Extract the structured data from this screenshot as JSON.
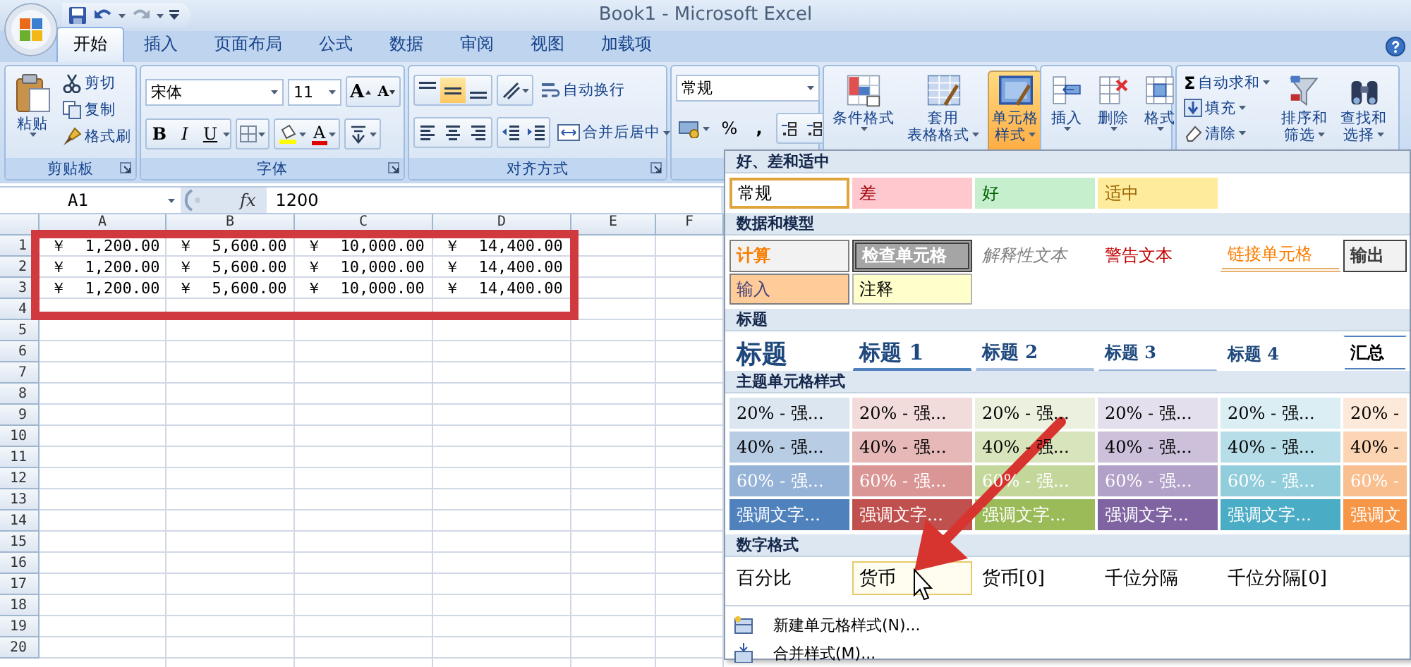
{
  "window": {
    "title": "Book1 - Microsoft Excel"
  },
  "tabs": [
    {
      "label": "开始",
      "selected": true
    },
    {
      "label": "插入",
      "selected": false
    },
    {
      "label": "页面布局",
      "selected": false
    },
    {
      "label": "公式",
      "selected": false
    },
    {
      "label": "数据",
      "selected": false
    },
    {
      "label": "审阅",
      "selected": false
    },
    {
      "label": "视图",
      "selected": false
    },
    {
      "label": "加载项",
      "selected": false
    }
  ],
  "ribbon": {
    "clipboard": {
      "label": "剪贴板",
      "paste": "粘贴",
      "commands": [
        "剪切",
        "复制",
        "格式刷"
      ]
    },
    "font": {
      "label": "字体",
      "font_name": "宋体",
      "font_size": "11",
      "grow": "A",
      "shrink": "A",
      "styles": [
        "B",
        "I",
        "U"
      ],
      "font_color": "A"
    },
    "alignment": {
      "label": "对齐方式",
      "wrap": "自动换行",
      "merge": "合并后居中"
    },
    "number": {
      "format": "常规",
      "percent": "%",
      "comma": ","
    },
    "styles": {
      "buttons": [
        {
          "lines": [
            "条件格式"
          ],
          "selected": false
        },
        {
          "lines": [
            "套用",
            "表格格式"
          ],
          "selected": false
        },
        {
          "lines": [
            "单元格",
            "样式"
          ],
          "selected": true
        }
      ]
    },
    "cells": {
      "buttons": [
        "插入",
        "删除",
        "格式"
      ]
    },
    "editing": {
      "sum_symbol": "Σ",
      "commands": [
        "自动求和",
        "填充",
        "清除"
      ],
      "buttons": [
        [
          "排序和",
          "筛选"
        ],
        [
          "查找和",
          "选择"
        ]
      ]
    }
  },
  "formula_bar": {
    "name_box": "A1",
    "function_label": "fx",
    "value": "1200"
  },
  "sheet": {
    "columns": [
      "A",
      "B",
      "C",
      "D",
      "E",
      "F"
    ],
    "rows": [
      {
        "label": "1",
        "cells": [
          "￥  1,200.00",
          "￥  5,600.00",
          "￥  10,000.00",
          "￥  14,400.00"
        ]
      },
      {
        "label": "2",
        "cells": [
          "￥  1,200.00",
          "￥  5,600.00",
          "￥  10,000.00",
          "￥  14,400.00"
        ]
      },
      {
        "label": "3",
        "cells": [
          "￥  1,200.00",
          "￥  5,600.00",
          "￥  10,000.00",
          "￥  14,400.00"
        ]
      },
      {
        "label": "4"
      },
      {
        "label": "5"
      },
      {
        "label": "6"
      },
      {
        "label": "7"
      },
      {
        "label": "8"
      },
      {
        "label": "9"
      },
      {
        "label": "10"
      },
      {
        "label": "11"
      },
      {
        "label": "12"
      },
      {
        "label": "13"
      },
      {
        "label": "14"
      },
      {
        "label": "15"
      },
      {
        "label": "16"
      },
      {
        "label": "17"
      },
      {
        "label": "18"
      },
      {
        "label": "19"
      },
      {
        "label": "20"
      }
    ]
  },
  "style_gallery": {
    "sections": [
      {
        "title": "好、差和适中",
        "rows": [
          {
            "items": [
              {
                "label": "常规",
                "kind": "normal",
                "selected": true
              },
              {
                "label": "差",
                "kind": "bad",
                "selected": false
              },
              {
                "label": "好",
                "kind": "good",
                "selected": false
              },
              {
                "label": "适中",
                "kind": "neutral",
                "selected": false
              }
            ]
          }
        ]
      },
      {
        "title": "数据和模型",
        "rows": [
          {
            "items": [
              {
                "label": "计算",
                "kind": "calculation"
              },
              {
                "label": "检查单元格",
                "kind": "check"
              },
              {
                "label": "解释性文本",
                "kind": "explanatory"
              },
              {
                "label": "警告文本",
                "kind": "warning"
              },
              {
                "label": "链接单元格",
                "kind": "linked"
              },
              {
                "label": "输出",
                "kind": "output"
              }
            ]
          },
          {
            "items": [
              {
                "label": "输入",
                "kind": "input"
              },
              {
                "label": "注释",
                "kind": "note"
              }
            ]
          }
        ]
      },
      {
        "title": "标题",
        "rows": [
          {
            "items": [
              {
                "label": "标题",
                "kind": "title"
              },
              {
                "label": "标题 1",
                "kind": "heading1"
              },
              {
                "label": "标题 2",
                "kind": "heading2"
              },
              {
                "label": "标题 3",
                "kind": "heading3"
              },
              {
                "label": "标题 4",
                "kind": "heading4"
              },
              {
                "label": "汇总",
                "kind": "total"
              }
            ]
          }
        ]
      },
      {
        "title": "主题单元格样式",
        "rows": [
          {
            "kind": "light",
            "items": [
              {
                "label": "20% - 强...",
                "kind": "accent",
                "color": "#dce6f1"
              },
              {
                "label": "20% - 强...",
                "kind": "accent",
                "color": "#f2dcdb"
              },
              {
                "label": "20% - 强...",
                "kind": "accent",
                "color": "#ebf1de"
              },
              {
                "label": "20% - 强...",
                "kind": "accent",
                "color": "#e4dfec"
              },
              {
                "label": "20% - 强...",
                "kind": "accent",
                "color": "#daeef3"
              },
              {
                "label": "20% -",
                "kind": "accent",
                "color": "#fde9d9"
              }
            ]
          },
          {
            "kind": "light",
            "items": [
              {
                "label": "40% - 强...",
                "kind": "accent",
                "color": "#b8cce4"
              },
              {
                "label": "40% - 强...",
                "kind": "accent",
                "color": "#e6b8b7"
              },
              {
                "label": "40% - 强...",
                "kind": "accent",
                "color": "#d8e4bc"
              },
              {
                "label": "40% - 强...",
                "kind": "accent",
                "color": "#ccc0da"
              },
              {
                "label": "40% - 强...",
                "kind": "accent",
                "color": "#b7dee8"
              },
              {
                "label": "40% -",
                "kind": "accent",
                "color": "#fcd5b4"
              }
            ]
          },
          {
            "kind": "dark",
            "items": [
              {
                "label": "60% - 强...",
                "kind": "accent",
                "color": "#95b3d7"
              },
              {
                "label": "60% - 强...",
                "kind": "accent",
                "color": "#da9694"
              },
              {
                "label": "60% - 强...",
                "kind": "accent",
                "color": "#c4d79b"
              },
              {
                "label": "60% - 强...",
                "kind": "accent",
                "color": "#b1a0c7"
              },
              {
                "label": "60% - 强...",
                "kind": "accent",
                "color": "#92cddc"
              },
              {
                "label": "60% -",
                "kind": "accent",
                "color": "#fabf8f"
              }
            ]
          },
          {
            "kind": "dark",
            "items": [
              {
                "label": "强调文字...",
                "kind": "accent",
                "color": "#4f81bd"
              },
              {
                "label": "强调文字...",
                "kind": "accent",
                "color": "#c0504d"
              },
              {
                "label": "强调文字...",
                "kind": "accent",
                "color": "#9bbb59"
              },
              {
                "label": "强调文字...",
                "kind": "accent",
                "color": "#8064a2"
              },
              {
                "label": "强调文字...",
                "kind": "accent",
                "color": "#4bacc6"
              },
              {
                "label": "强调文",
                "kind": "accent",
                "color": "#f79646"
              }
            ]
          }
        ]
      },
      {
        "title": "数字格式",
        "rows": [
          {
            "items": [
              {
                "label": "百分比",
                "kind": "number",
                "hovered": false
              },
              {
                "label": "货币",
                "kind": "number",
                "hovered": true
              },
              {
                "label": "货币[0]",
                "kind": "number",
                "hovered": false
              },
              {
                "label": "千位分隔",
                "kind": "number",
                "hovered": false
              },
              {
                "label": "千位分隔[0]",
                "kind": "number",
                "hovered": false
              }
            ]
          }
        ]
      }
    ],
    "menu_items": [
      "新建单元格样式(N)...",
      "合并样式(M)..."
    ]
  }
}
